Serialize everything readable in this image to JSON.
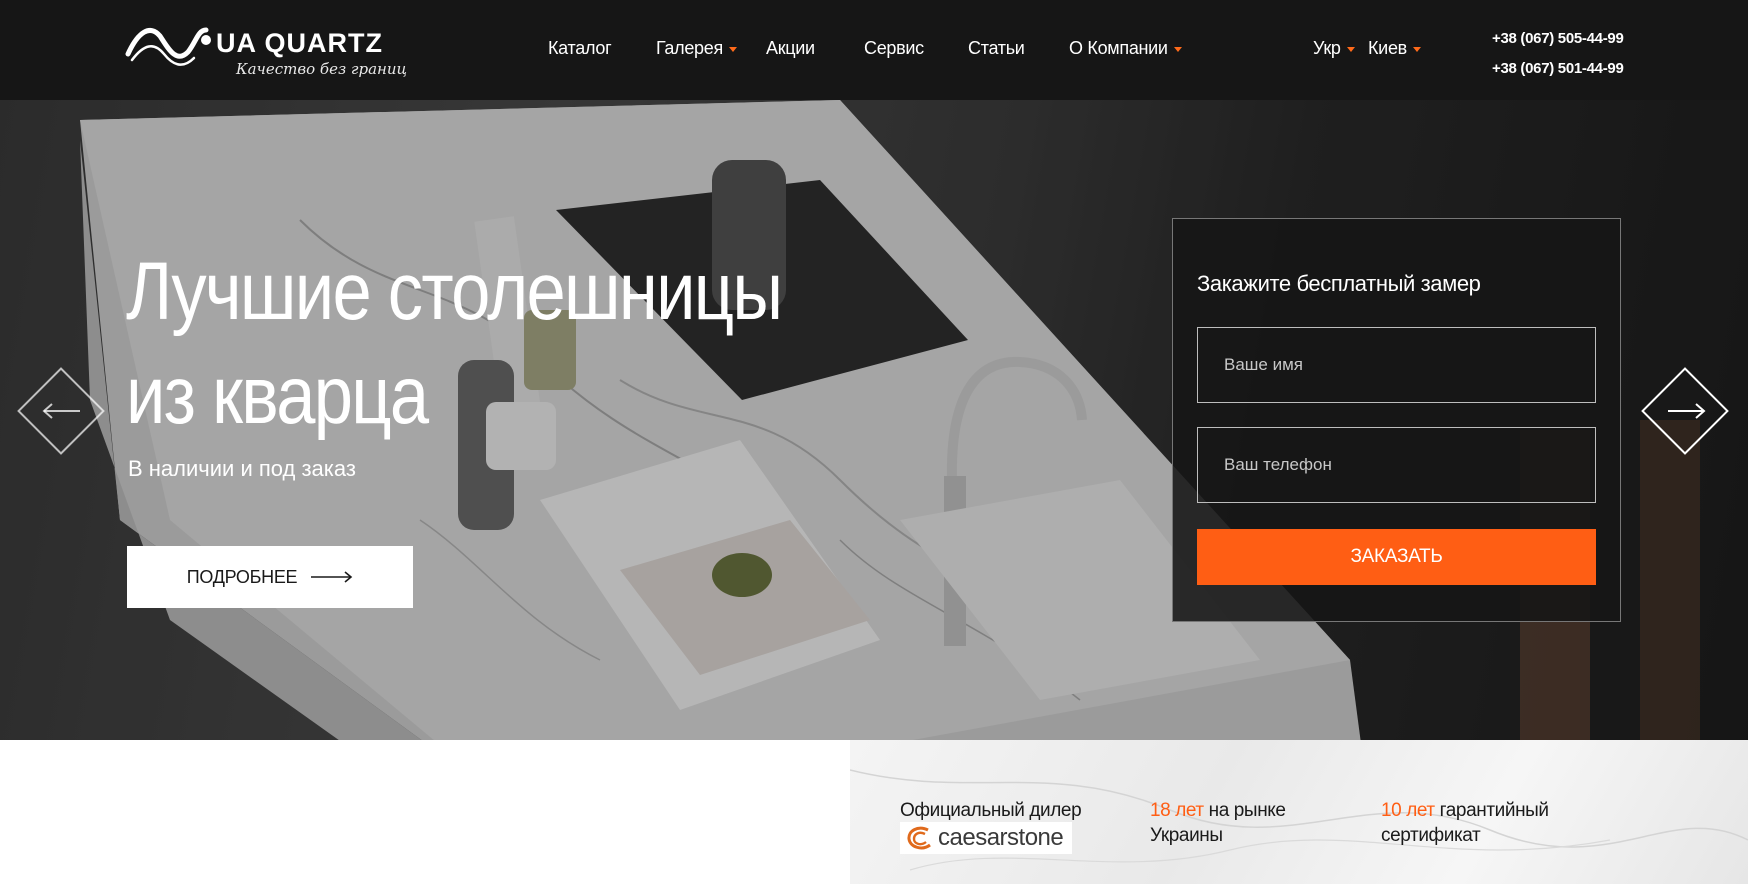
{
  "header": {
    "logo_text": "UA QUARTZ",
    "logo_tagline": "Качество без границ",
    "nav": [
      {
        "label": "Каталог",
        "dropdown": false
      },
      {
        "label": "Галерея",
        "dropdown": true
      },
      {
        "label": "Акции",
        "dropdown": false
      },
      {
        "label": "Сервис",
        "dropdown": false
      },
      {
        "label": "Статьи",
        "dropdown": false
      },
      {
        "label": "О Компании",
        "dropdown": true
      }
    ],
    "language": "Укр",
    "city": "Киев",
    "phones": [
      "+38 (067) 505-44-99",
      "+38 (067) 501-44-99"
    ]
  },
  "hero": {
    "headline_line1": "Лучшие столешницы",
    "headline_line2": "из кварца",
    "subtitle": "В наличии и под заказ",
    "more_button": "ПОДРОБНЕЕ"
  },
  "order_form": {
    "title": "Закажите бесплатный замер",
    "name_placeholder": "Ваше имя",
    "phone_placeholder": "Ваш телефон",
    "submit_label": "ЗАКАЗАТЬ"
  },
  "features": {
    "dealer_label": "Официальный дилер",
    "dealer_brand": "caesarstone",
    "years_market_accent": "18 лет",
    "years_market_rest": " на рынке",
    "years_market_line2": "Украины",
    "warranty_accent": "10 лет",
    "warranty_rest": " гарантийный",
    "warranty_line2": "сертификат"
  },
  "colors": {
    "header_bg": "#161616",
    "accent": "#ff5e14",
    "text": "#ffffff"
  },
  "icons": [
    "logo-wave-icon",
    "chevron-down-icon",
    "arrow-left-icon",
    "arrow-right-icon",
    "caesarstone-logo-icon"
  ]
}
